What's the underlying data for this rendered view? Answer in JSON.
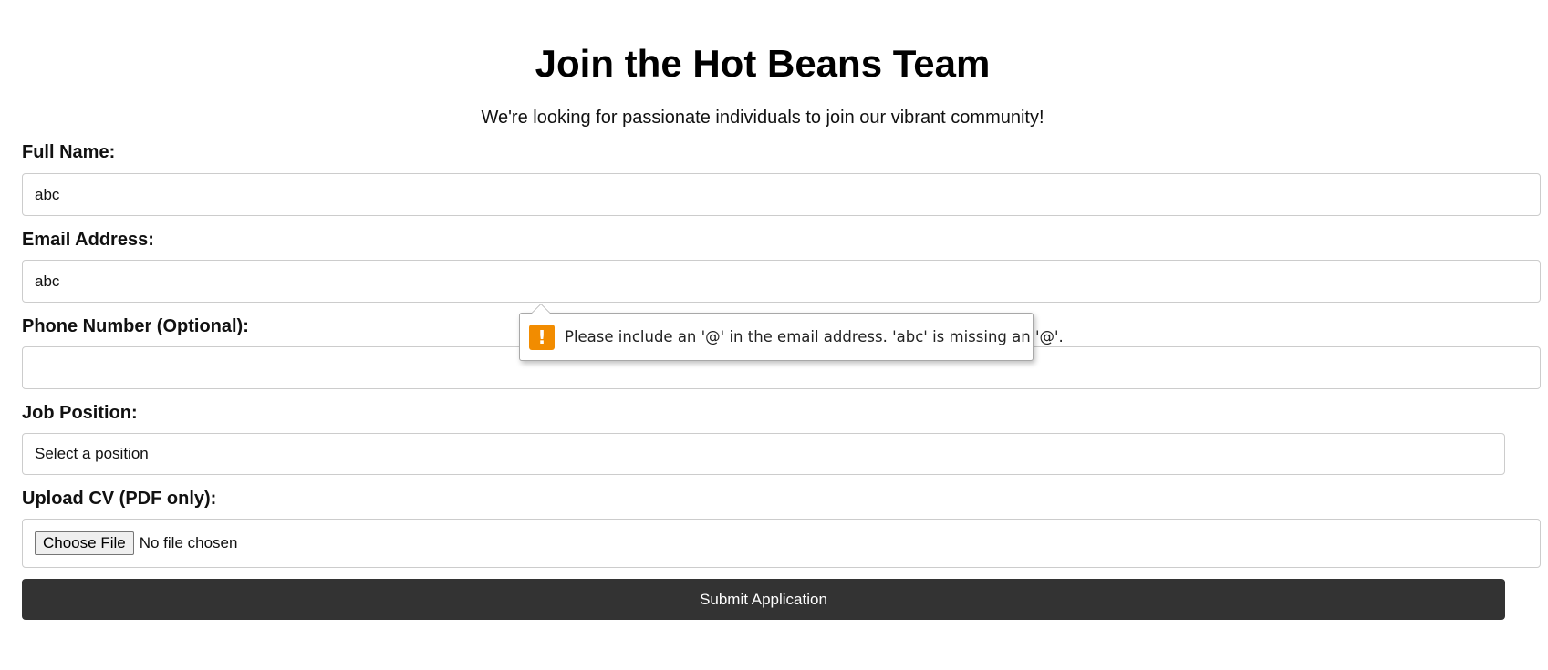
{
  "header": {
    "title": "Join the Hot Beans Team",
    "subtitle": "We're looking for passionate individuals to join our vibrant community!"
  },
  "form": {
    "full_name": {
      "label": "Full Name:",
      "value": "abc"
    },
    "email": {
      "label": "Email Address:",
      "value": "abc"
    },
    "phone": {
      "label": "Phone Number (Optional):",
      "value": ""
    },
    "job_position": {
      "label": "Job Position:",
      "selected": "Select a position"
    },
    "cv_upload": {
      "label": "Upload CV (PDF only):",
      "button_label": "Choose File",
      "status": "No file chosen"
    },
    "submit_label": "Submit Application"
  },
  "validation_tooltip": {
    "icon": "warning-icon",
    "icon_color": "#f28c00",
    "message": "Please include an '@' in the email address. 'abc' is missing an '@'."
  },
  "colors": {
    "submit_background": "#333333",
    "submit_text": "#ffffff",
    "input_border": "#cccccc"
  }
}
